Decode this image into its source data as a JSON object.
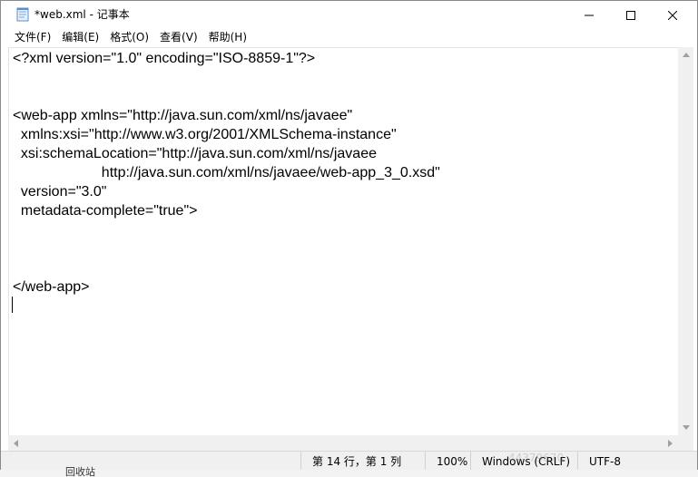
{
  "window": {
    "title": "*web.xml - 记事本",
    "icons": {
      "app": "notepad-icon",
      "minimize": "minimize-icon",
      "maximize": "maximize-icon",
      "close": "close-icon"
    }
  },
  "menu": [
    {
      "label": "文件(F)"
    },
    {
      "label": "编辑(E)"
    },
    {
      "label": "格式(O)"
    },
    {
      "label": "查看(V)"
    },
    {
      "label": "帮助(H)"
    }
  ],
  "editor": {
    "content": "<?xml version=\"1.0\" encoding=\"ISO-8859-1\"?>\n\n\n<web-app xmlns=\"http://java.sun.com/xml/ns/javaee\"\n  xmlns:xsi=\"http://www.w3.org/2001/XMLSchema-instance\"\n  xsi:schemaLocation=\"http://java.sun.com/xml/ns/javaee\n                      http://java.sun.com/xml/ns/javaee/web-app_3_0.xsd\"\n  version=\"3.0\"\n  metadata-complete=\"true\">\n\n\n\n</web-app>\n"
  },
  "status": {
    "position": "第 14 行，第 1 列",
    "zoom": "100%",
    "line_ending": "Windows (CRLF)",
    "encoding": "UTF-8"
  },
  "background": {
    "partial_item": "回收站"
  },
  "watermark": "44379670"
}
